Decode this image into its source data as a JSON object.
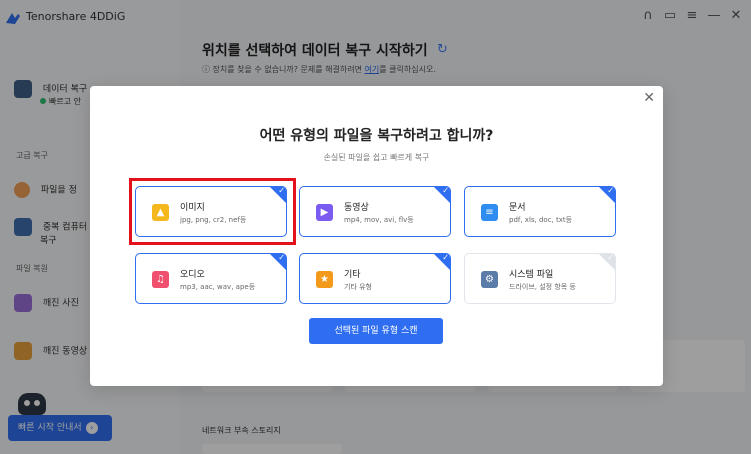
{
  "app": {
    "title": "Tenorshare 4DDiG",
    "heading": "위치를 선택하여 데이터 복구 시작하기",
    "help_prefix": "ⓘ 장치를 찾을 수 없습니까? 문제를 해결하려면 ",
    "help_link": "여기",
    "help_suffix": "를 클릭하십시오.",
    "network_label": "네트워크 부속 스토리지"
  },
  "sidebar": {
    "data_recovery": "데이터 복구",
    "status": "빠르고 안",
    "section_advanced": "고급 복구",
    "file_repair": "파일을 정",
    "duplicate": "중복 컴퓨터",
    "duplicate_sub": "복구",
    "section_file_repair": "파일 복원",
    "photo_repair": "깨진 사진",
    "video_repair": "깨진 동영상",
    "quick_start": "빠른 시작 안내서"
  },
  "window_controls": [
    "headset-icon",
    "feedback-icon",
    "menu-icon",
    "minimize-icon",
    "close-icon"
  ],
  "modal": {
    "title": "어떤 유형의 파일을 복구하려고 합니까?",
    "subtitle": "손실된 파일을 쉽고 빠르게 복구",
    "close": "✕",
    "scan_button": "선택된 파일 유형 스캔",
    "types": [
      {
        "name": "이미지",
        "desc": "jpg, png, cr2, nef등",
        "color": "#f5b81c",
        "icon": "image-icon",
        "selected": true
      },
      {
        "name": "동영상",
        "desc": "mp4, mov, avi, flv등",
        "color": "#7a5df0",
        "icon": "video-icon",
        "selected": true
      },
      {
        "name": "문서",
        "desc": "pdf, xls, doc, txt등",
        "color": "#2f8cf0",
        "icon": "document-icon",
        "selected": true
      },
      {
        "name": "오디오",
        "desc": "mp3, aac, wav, ape등",
        "color": "#f0506e",
        "icon": "audio-icon",
        "selected": true
      },
      {
        "name": "기타",
        "desc": "기타 유형",
        "color": "#f39a1b",
        "icon": "star-icon",
        "selected": true
      },
      {
        "name": "시스템 파일",
        "desc": "드라이브, 설정 항목 등",
        "color": "#5b7ba8",
        "icon": "system-file-icon",
        "selected": false
      }
    ]
  }
}
